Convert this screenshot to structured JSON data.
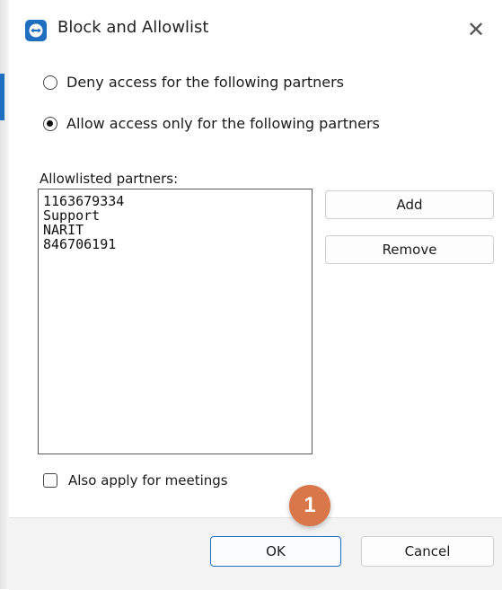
{
  "window": {
    "title": "Block and Allowlist",
    "close_glyph": "✕"
  },
  "options": {
    "deny_label": "Deny access for the following partners",
    "allow_label": "Allow access only for the following partners",
    "selected": "allow"
  },
  "allowlist": {
    "label": "Allowlisted partners:",
    "items": [
      "1163679334",
      "Support",
      "NARIT",
      "846706191"
    ]
  },
  "buttons": {
    "add": "Add",
    "remove": "Remove",
    "ok": "OK",
    "cancel": "Cancel"
  },
  "meetings": {
    "label": "Also apply for meetings",
    "checked": false
  },
  "annotation": {
    "step_number": "1",
    "color": "#d9774a"
  },
  "colors": {
    "accent": "#1f6fc1",
    "ok_border": "#1f6fc1"
  }
}
